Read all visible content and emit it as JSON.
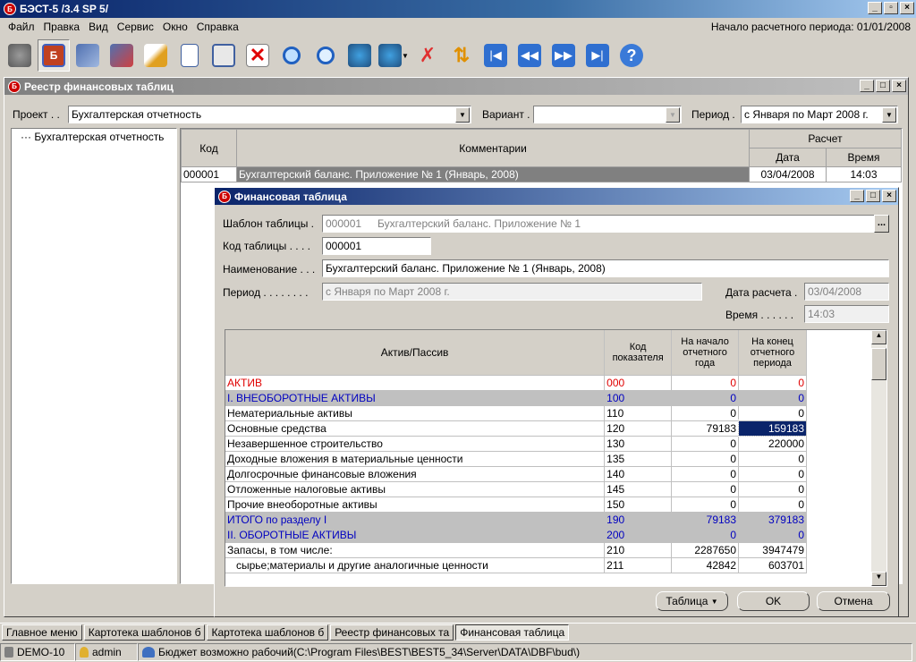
{
  "app": {
    "title": "БЭСТ-5 /3.4 SP 5/",
    "icon_letter": "Б"
  },
  "menu": [
    "Файл",
    "Правка",
    "Вид",
    "Сервис",
    "Окно",
    "Справка"
  ],
  "period_info": "Начало расчетного периода: 01/01/2008",
  "toolbar_icons": [
    "puzzle-icon",
    "registry-icon",
    "disks-icon",
    "disk-edit-icon",
    "pencil-icon",
    "new-doc-icon",
    "save-icon",
    "delete-icon",
    "zoom-icon",
    "search-icon",
    "people-icon",
    "people-icon",
    "filter-off-icon",
    "sort-icon",
    "first-icon",
    "prev-icon",
    "next-icon",
    "last-icon",
    "help-icon"
  ],
  "registry": {
    "title": "Реестр финансовых таблиц",
    "project_label": "Проект . .",
    "project_value": "Бухгалтерская отчетность",
    "variant_label": "Вариант .",
    "variant_value": "",
    "period_label": "Период .",
    "period_value": "с Января по Март 2008 г.",
    "tree_item": "Бухгалтерская отчетность",
    "col_code": "Код",
    "col_comment": "Комментарии",
    "col_calc": "Расчет",
    "col_date": "Дата",
    "col_time": "Время",
    "rows": [
      {
        "code": "000001",
        "comment": "Бухгалтерский баланс. Приложение № 1 (Январь, 2008)",
        "date": "03/04/2008",
        "time": "14:03"
      }
    ]
  },
  "fin": {
    "title": "Финансовая таблица",
    "template_label": "Шаблон таблицы .",
    "template_code": "000001",
    "template_name": "Бухгалтерский баланс. Приложение № 1",
    "browse": "...",
    "code_label": "Код таблицы . . . .",
    "code_value": "000001",
    "name_label": "Наименование . . .",
    "name_value": "Бухгалтерский баланс. Приложение № 1 (Январь, 2008)",
    "period_label": "Период . . . . . . . .",
    "period_value": "с Января по Март 2008 г.",
    "calcdate_label": "Дата расчета .",
    "calcdate_value": "03/04/2008",
    "time_label": "Время . . . . . .",
    "time_value": "14:03",
    "col_item": "Актив/Пассив",
    "col_code": "Код показателя",
    "col_begin": "На начало отчетного года",
    "col_end": "На конец отчетного периода",
    "rows": [
      {
        "name": "АКТИВ",
        "code": "000",
        "begin": "0",
        "end": "0",
        "style": "red"
      },
      {
        "name": "I. ВНЕОБОРОТНЫЕ АКТИВЫ",
        "code": "100",
        "begin": "0",
        "end": "0",
        "style": "grey"
      },
      {
        "name": "Нематериальные активы",
        "code": "110",
        "begin": "0",
        "end": "0",
        "style": ""
      },
      {
        "name": "Основные средства",
        "code": "120",
        "begin": "79183",
        "end": "159183",
        "style": "sel"
      },
      {
        "name": "Незавершенное строительство",
        "code": "130",
        "begin": "0",
        "end": "220000",
        "style": ""
      },
      {
        "name": "Доходные вложения в материальные ценности",
        "code": "135",
        "begin": "0",
        "end": "0",
        "style": ""
      },
      {
        "name": "Долгосрочные финансовые вложения",
        "code": "140",
        "begin": "0",
        "end": "0",
        "style": ""
      },
      {
        "name": "Отложенные налоговые активы",
        "code": "145",
        "begin": "0",
        "end": "0",
        "style": ""
      },
      {
        "name": "Прочие внеоборотные активы",
        "code": "150",
        "begin": "0",
        "end": "0",
        "style": ""
      },
      {
        "name": "ИТОГО по разделу I",
        "code": "190",
        "begin": "79183",
        "end": "379183",
        "style": "grey"
      },
      {
        "name": "II. ОБОРОТНЫЕ АКТИВЫ",
        "code": "200",
        "begin": "0",
        "end": "0",
        "style": "grey"
      },
      {
        "name": "Запасы, в том числе:",
        "code": "210",
        "begin": "2287650",
        "end": "3947479",
        "style": ""
      },
      {
        "name": "   сырье;материалы и другие аналогичные ценности",
        "code": "211",
        "begin": "42842",
        "end": "603701",
        "style": ""
      }
    ],
    "btn_table": "Таблица",
    "btn_ok": "OK",
    "btn_cancel": "Отмена"
  },
  "tasks": [
    "Главное меню",
    "Картотека шаблонов б",
    "Картотека шаблонов б",
    "Реестр финансовых та",
    "Финансовая таблица"
  ],
  "status": {
    "db": "DEMO-10",
    "user": "admin",
    "path": "Бюджет возможно рабочий(C:\\Program Files\\BEST\\BEST5_34\\Server\\DATA\\DBF\\bud\\)"
  },
  "colors": {
    "title_active": "#0a246a",
    "selected_cell": "#0a246a",
    "red_text": "#e00000",
    "blue_text": "#0000c0",
    "grey_row": "#c0c0c0"
  }
}
